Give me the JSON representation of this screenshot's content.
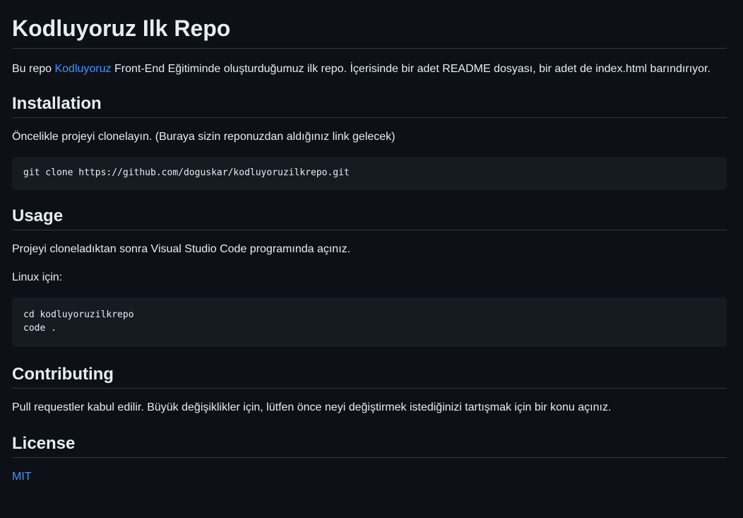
{
  "title": "Kodluyoruz Ilk Repo",
  "intro": {
    "before": "Bu repo ",
    "link": "Kodluyoruz",
    "after": " Front-End Eğitiminde oluşturduğumuz ilk repo. İçerisinde bir adet README dosyası, bir adet de index.html barındırıyor."
  },
  "installation": {
    "heading": "Installation",
    "text": "Öncelikle projeyi clonelayın. (Buraya sizin reponuzdan aldığınız link gelecek)",
    "code": "git clone https://github.com/doguskar/kodluyoruzilkrepo.git"
  },
  "usage": {
    "heading": "Usage",
    "text": "Projeyi cloneladıktan sonra Visual Studio Code programında açınız.",
    "linux_label": "Linux için:",
    "code": "cd kodluyoruzilkrepo\ncode ."
  },
  "contributing": {
    "heading": "Contributing",
    "text": "Pull requestler kabul edilir. Büyük değişiklikler için, lütfen önce neyi değiştirmek istediğinizi tartışmak için bir konu açınız."
  },
  "license": {
    "heading": "License",
    "link": "MIT"
  }
}
